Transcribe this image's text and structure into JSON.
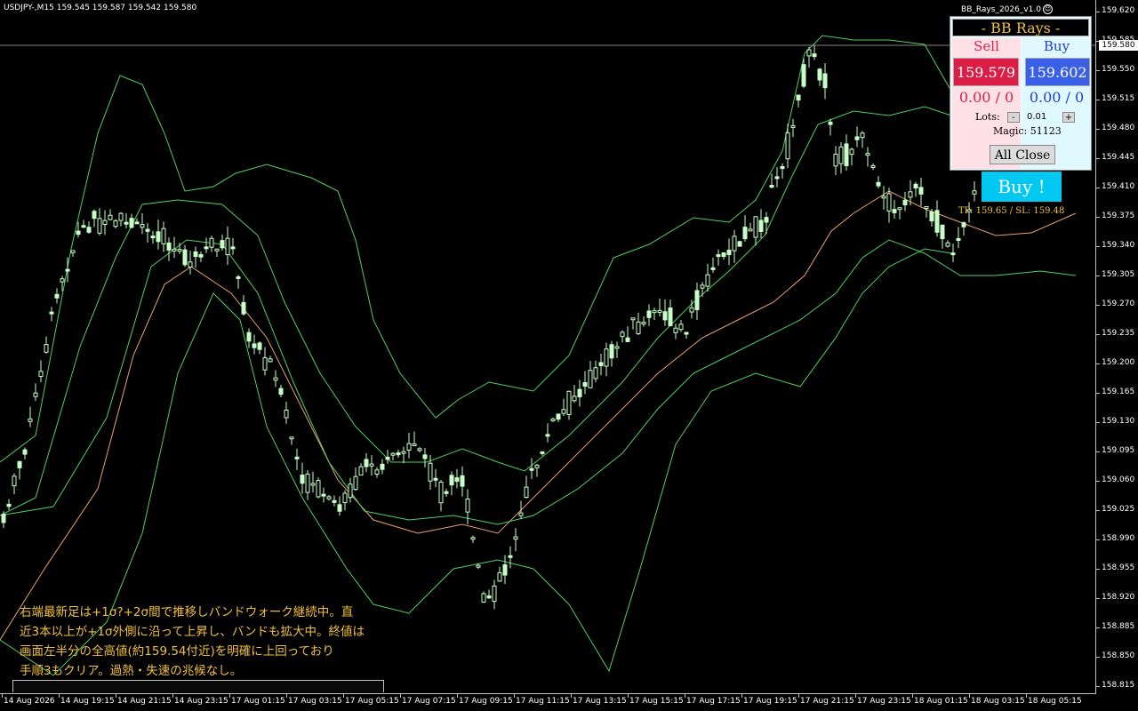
{
  "symbol_info": "USDJPY-,M15  159.545 159.587 159.542 159.580",
  "ea_name": "BB_Rays_2026_v1.0",
  "current_price": "159.580",
  "price_axis": [
    "159.620",
    "159.585",
    "159.550",
    "159.515",
    "159.480",
    "159.445",
    "159.410",
    "159.375",
    "159.340",
    "159.305",
    "159.270",
    "159.235",
    "159.200",
    "159.165",
    "159.130",
    "159.095",
    "159.060",
    "159.025",
    "158.990",
    "158.955",
    "158.920",
    "158.885",
    "158.850",
    "158.815"
  ],
  "time_axis": [
    "14 Aug 2026",
    "14 Aug 19:15",
    "14 Aug 21:15",
    "14 Aug 23:15",
    "17 Aug 01:15",
    "17 Aug 03:15",
    "17 Aug 05:15",
    "17 Aug 07:15",
    "17 Aug 09:15",
    "17 Aug 11:15",
    "17 Aug 13:15",
    "17 Aug 15:15",
    "17 Aug 17:15",
    "17 Aug 19:15",
    "17 Aug 21:15",
    "17 Aug 23:15",
    "18 Aug 01:15",
    "18 Aug 03:15",
    "18 Aug 05:15"
  ],
  "panel": {
    "title": "- BB Rays -",
    "sell_label": "Sell",
    "buy_label": "Buy",
    "sell_price": "159.579",
    "buy_price": "159.602",
    "sell_pl": "0.00 / 0",
    "buy_pl": "0.00 / 0",
    "lots_label": "Lots:",
    "lots_minus": "-",
    "lots_value": "0.01",
    "lots_plus": "+",
    "magic_label": "Magic:",
    "magic_value": "51123",
    "all_close": "All Close"
  },
  "signal": {
    "label": "Buy !",
    "tp_sl": "TP: 159.65 / SL: 159.48"
  },
  "commentary": [
    "右端最新足は+1σ?+2σ間で推移しバンドウォーク継続中。直",
    "近3本以上が+1σ外側に沿って上昇し、バンドも拡大中。終値は",
    "画面左半分の全高値(約159.54付近)を明確に上回っており",
    "手順3もクリア。過熱・失速の兆候なし。"
  ],
  "colors": {
    "background": "#000000",
    "candle": "#c8ffc8",
    "band_outer": "#50d060",
    "band_mid": "#e8a070",
    "text_accent": "#f0c040"
  },
  "icons": {
    "status": "smiley-icon"
  }
}
